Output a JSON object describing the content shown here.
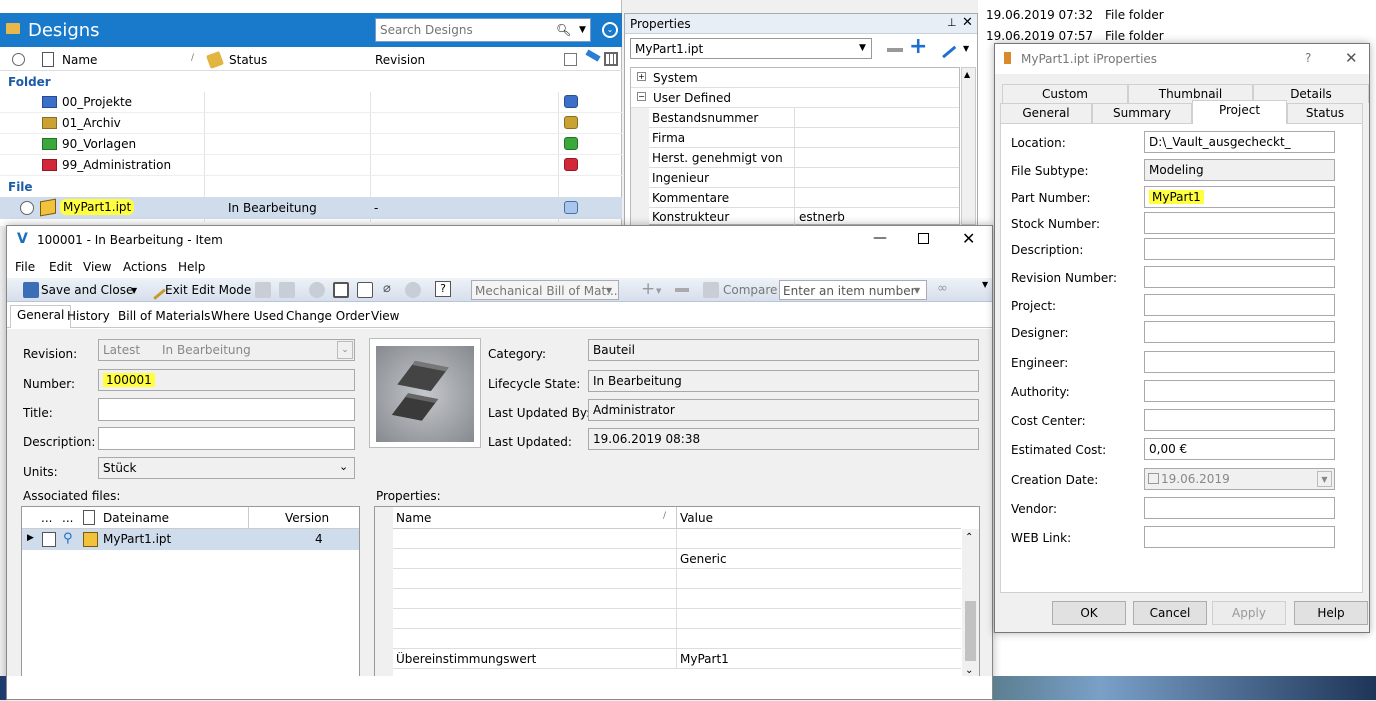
{
  "vault": {
    "title": "Designs",
    "search_placeholder": "Search Designs",
    "columns": {
      "name": "Name",
      "status": "Status",
      "revision": "Revision"
    },
    "groups": {
      "folder": "Folder",
      "file": "File"
    },
    "folders": [
      {
        "name": "00_Projekte",
        "color": "#3b6fc9"
      },
      {
        "name": "01_Archiv",
        "color": "#c9a233"
      },
      {
        "name": "90_Vorlagen",
        "color": "#3aa83a"
      },
      {
        "name": "99_Administration",
        "color": "#d2283a"
      }
    ],
    "file": {
      "name": "MyPart1.ipt",
      "status": "In Bearbeitung",
      "revision": "-"
    }
  },
  "properties_panel": {
    "title": "Properties",
    "selected": "MyPart1.ipt",
    "sections": {
      "system": "System",
      "user_defined": "User Defined"
    },
    "rows": [
      {
        "name": "Bestandsnummer",
        "value": ""
      },
      {
        "name": "Firma",
        "value": ""
      },
      {
        "name": "Herst. genehmigt von",
        "value": ""
      },
      {
        "name": "Ingenieur",
        "value": ""
      },
      {
        "name": "Kommentare",
        "value": ""
      },
      {
        "name": "Konstrukteur",
        "value": "estnerb"
      }
    ]
  },
  "explorer_bg": {
    "rows": [
      {
        "date": "19.06.2019 07:32",
        "type": "File folder"
      },
      {
        "date": "19.06.2019 07:57",
        "type": "File folder"
      }
    ]
  },
  "item": {
    "title": "100001 - In Bearbeitung - Item",
    "menu": [
      "File",
      "Edit",
      "View",
      "Actions",
      "Help"
    ],
    "toolbar": {
      "save_close": "Save and Close",
      "exit_edit": "Exit Edit Mode",
      "bom_select": "Mechanical Bill of Mat...",
      "compare": "Compare",
      "item_placeholder": "Enter an item number"
    },
    "tabs": [
      "General",
      "History",
      "Bill of Materials",
      "Where Used",
      "Change Order",
      "View"
    ],
    "labels": {
      "revision": "Revision:",
      "number": "Number:",
      "title": "Title:",
      "description": "Description:",
      "units": "Units:",
      "associated": "Associated files:",
      "category": "Category:",
      "lifecycle": "Lifecycle State:",
      "updated_by": "Last Updated By:",
      "updated": "Last Updated:",
      "properties": "Properties:"
    },
    "values": {
      "revision_latest": "Latest",
      "revision_state": "In Bearbeitung",
      "number": "100001",
      "title": "",
      "description": "",
      "units": "Stück",
      "category": "Bauteil",
      "lifecycle": "In Bearbeitung",
      "updated_by": "Administrator",
      "updated": "19.06.2019 08:38"
    },
    "assoc": {
      "col_dots1": "...",
      "col_dots2": "...",
      "col_name": "Dateiname",
      "col_version": "Version",
      "row": {
        "name": "MyPart1.ipt",
        "version": "4"
      }
    },
    "props": {
      "col_name": "Name",
      "col_value": "Value",
      "rows": [
        {
          "name": "",
          "value": "Generic"
        },
        {
          "name": "",
          "value": ""
        },
        {
          "name": "",
          "value": ""
        },
        {
          "name": "",
          "value": ""
        },
        {
          "name": "",
          "value": ""
        },
        {
          "name": "Übereinstimmungswert",
          "value": "MyPart1"
        }
      ]
    }
  },
  "iprops": {
    "title": "MyPart1.ipt iProperties",
    "help": "?",
    "tabs_back": [
      "Custom",
      "Thumbnail",
      "Details"
    ],
    "tabs_front": [
      "General",
      "Summary",
      "Project",
      "Status"
    ],
    "labels": [
      "Location:",
      "File Subtype:",
      "Part Number:",
      "Stock Number:",
      "Description:",
      "Revision Number:",
      "Project:",
      "Designer:",
      "Engineer:",
      "Authority:",
      "Cost Center:",
      "Estimated Cost:",
      "Creation Date:",
      "Vendor:",
      "WEB Link:"
    ],
    "values": {
      "location": "D:\\_Vault_ausgecheckt_",
      "subtype": "Modeling",
      "part_number": "MyPart1",
      "estimated_cost": "0,00 €",
      "creation_date": "19.06.2019"
    },
    "buttons": {
      "ok": "OK",
      "cancel": "Cancel",
      "apply": "Apply",
      "help": "Help"
    }
  }
}
